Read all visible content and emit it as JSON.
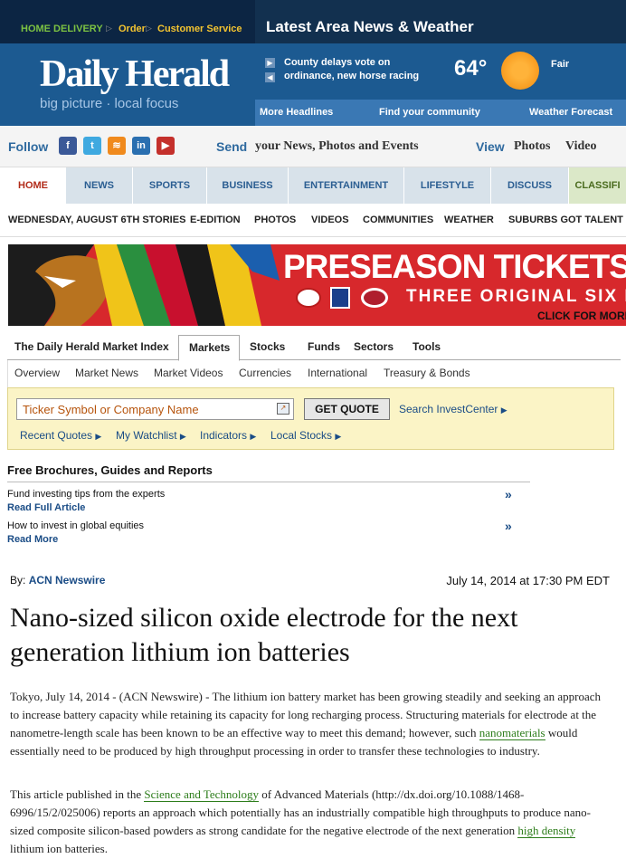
{
  "header": {
    "home_delivery": "HOME DELIVERY",
    "order": "Order",
    "customer_service": "Customer Service",
    "latest_news": "Latest Area News & Weather",
    "logo": "Daily Herald",
    "tagline": "big picture · local focus",
    "headline_snippet": "County delays vote on ordinance, new horse racing",
    "temperature": "64°",
    "condition": "Fair",
    "more_headlines": "More Headlines",
    "find_community": "Find your community",
    "weather_forecast": "Weather Forecast"
  },
  "social": {
    "follow": "Follow",
    "send": "Send",
    "send_text": "your News, Photos and Events",
    "view": "View",
    "photos": "Photos",
    "video": "Video",
    "icons": [
      "facebook-icon",
      "twitter-icon",
      "rss-icon",
      "linkedin-icon",
      "youtube-icon"
    ]
  },
  "nav": {
    "tabs": [
      "HOME",
      "NEWS",
      "SPORTS",
      "BUSINESS",
      "ENTERTAINMENT",
      "LIFESTYLE",
      "DISCUSS",
      "CLASSIFI"
    ],
    "sub": [
      "WEDNESDAY, AUGUST 6TH STORIES",
      "E-EDITION",
      "PHOTOS",
      "VIDEOS",
      "COMMUNITIES",
      "WEATHER",
      "SUBURBS GOT TALENT"
    ]
  },
  "ad": {
    "line1": "PRESEASON TICKETS ON SALE NO",
    "line2": "THREE ORIGINAL SIX MATCH",
    "line3": "CLICK FOR MORE"
  },
  "markets": {
    "tabs": [
      "The Daily Herald Market Index",
      "Markets",
      "Stocks",
      "Funds",
      "Sectors",
      "Tools"
    ],
    "subtabs": [
      "Overview",
      "Market News",
      "Market Videos",
      "Currencies",
      "International",
      "Treasury & Bonds"
    ],
    "ticker_placeholder": "Ticker Symbol or Company Name",
    "get_quote": "GET QUOTE",
    "search_investcenter": "Search InvestCenter",
    "quick_links": [
      "Recent Quotes",
      "My Watchlist",
      "Indicators",
      "Local Stocks"
    ]
  },
  "brochures": {
    "title": "Free Brochures, Guides and Reports",
    "items": [
      {
        "text": "Fund investing tips from the experts",
        "link": "Read Full Article"
      },
      {
        "text": "How to invest in global equities",
        "link": "Read More"
      }
    ]
  },
  "article": {
    "by": "By:",
    "author": "ACN Newswire",
    "date": "July 14, 2014 at 17:30 PM EDT",
    "headline": "Nano-sized silicon oxide electrode for the next generation lithium ion batteries",
    "p1_a": "Tokyo, July 14, 2014 - (ACN Newswire) - The lithium ion battery market has been growing steadily and seeking an approach to increase battery capacity while retaining its capacity for long recharging process. Structuring materials for electrode at the nanometre-length scale has been known to be an effective way to meet this demand; however, such ",
    "p1_link": "nanomaterials",
    "p1_b": " would essentially need to be produced by high throughput processing in order to transfer these technologies to industry.",
    "p2_a": "This article published in the ",
    "p2_link1": "Science and Technology",
    "p2_b": " of Advanced Materials (http://dx.doi.org/10.1088/1468-6996/15/2/025006) reports an approach which potentially has an industrially compatible high throughputs to produce nano-sized composite silicon-based powders as strong candidate for the negative electrode of the next generation ",
    "p2_link2": "high density",
    "p2_c": " lithium ion batteries."
  },
  "colors": {
    "masthead": "#173f6c",
    "accent_green": "#2d7d1b",
    "ad_red": "#d7282c",
    "quote_box": "#fbf4c6"
  }
}
